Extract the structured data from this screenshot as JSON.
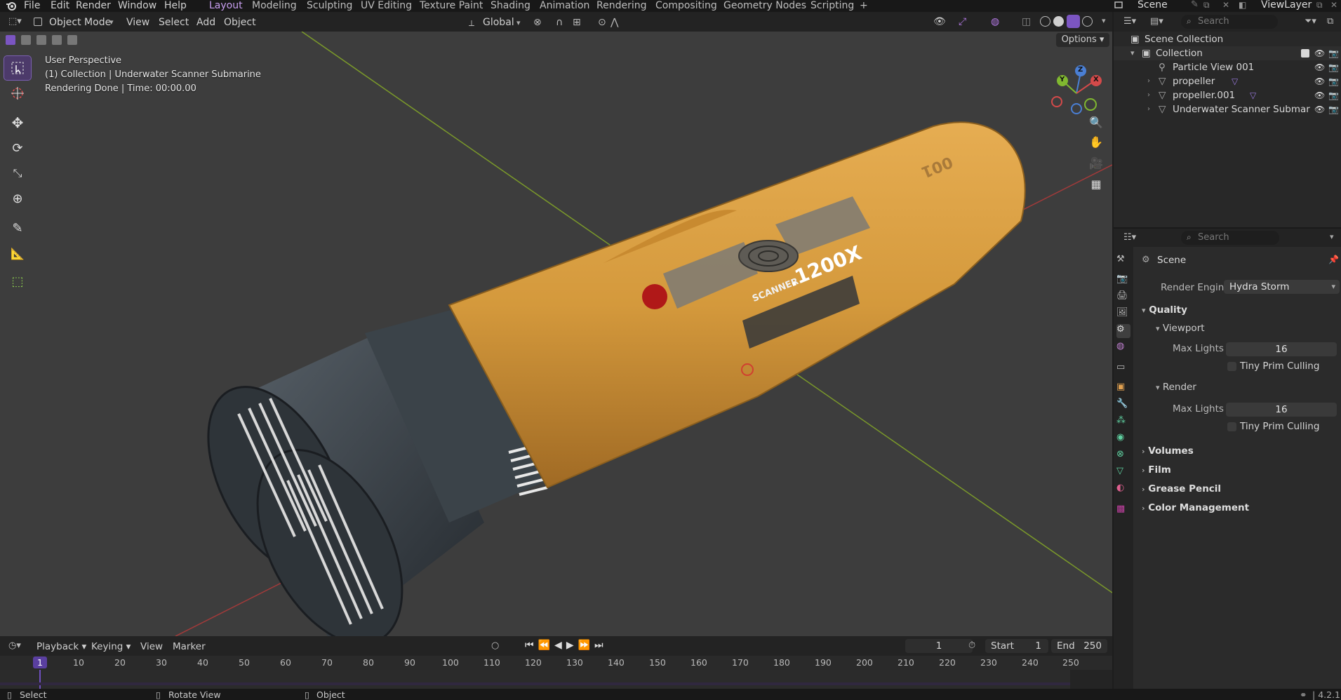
{
  "top_menu": {
    "items": [
      "File",
      "Edit",
      "Render",
      "Window",
      "Help"
    ]
  },
  "workspaces": {
    "tabs": [
      "Layout",
      "Modeling",
      "Sculpting",
      "UV Editing",
      "Texture Paint",
      "Shading",
      "Animation",
      "Rendering",
      "Compositing",
      "Geometry Nodes",
      "Scripting"
    ],
    "active": "Layout",
    "add_label": "+"
  },
  "scene_selector": {
    "scene": "Scene",
    "view_layer": "ViewLayer"
  },
  "viewport_header": {
    "mode": "Object Mode",
    "menus": [
      "View",
      "Select",
      "Add",
      "Object"
    ],
    "orientation": "Global",
    "options_label": "Options"
  },
  "viewport_overlay": {
    "view_name": "User Perspective",
    "collection_line_prefix": "(1) Collection",
    "object_name": "Underwater Scanner Submarine",
    "render_status": "Rendering Done",
    "time": "Time: 00:00.00"
  },
  "model_text": {
    "label_small": "SCANNER",
    "label_big": ".1200X",
    "hull_number": "001"
  },
  "gizmo": {
    "x": "X",
    "y": "Y",
    "z": "Z"
  },
  "outliner": {
    "search_placeholder": "Search",
    "root": "Scene Collection",
    "collection": "Collection",
    "items": [
      "Particle View 001",
      "propeller",
      "propeller.001",
      "Underwater Scanner Submar"
    ]
  },
  "properties": {
    "search_placeholder": "Search",
    "context": "Scene",
    "render_engine_label": "Render Engine",
    "render_engine_value": "Hydra Storm",
    "quality_section": "Quality",
    "viewport_sub": "Viewport",
    "viewport_max_lights_label": "Max Lights",
    "viewport_max_lights_value": "16",
    "viewport_tiny_prim": "Tiny Prim Culling",
    "render_sub": "Render",
    "render_max_lights_label": "Max Lights",
    "render_max_lights_value": "16",
    "render_tiny_prim": "Tiny Prim Culling",
    "collapsed_sections": [
      "Volumes",
      "Film",
      "Grease Pencil",
      "Color Management"
    ]
  },
  "timeline": {
    "menus": [
      "Playback",
      "Keying",
      "View",
      "Marker"
    ],
    "current_frame": "1",
    "start_label": "Start",
    "start_value": "1",
    "end_label": "End",
    "end_value": "250",
    "ruler_marks": [
      "1",
      "10",
      "20",
      "30",
      "40",
      "50",
      "60",
      "70",
      "80",
      "90",
      "100",
      "110",
      "120",
      "130",
      "140",
      "150",
      "160",
      "170",
      "180",
      "190",
      "200",
      "210",
      "220",
      "230",
      "240",
      "250"
    ]
  },
  "status_bar": {
    "select": "Select",
    "rotate": "Rotate View",
    "object": "Object",
    "version": "4.2.1"
  },
  "colors": {
    "accent_purple": "#7b55c2",
    "workspace_active": "#c89ef0",
    "hull_orange": "#d49a3c",
    "viewport_bg": "#3d3d3d"
  }
}
